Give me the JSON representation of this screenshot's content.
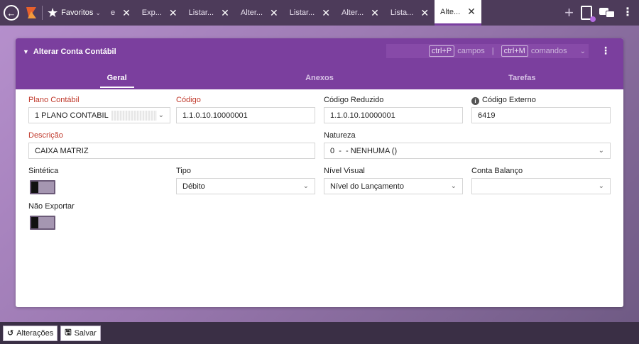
{
  "topbar": {
    "favorites_label": "Favoritos",
    "tabs": [
      {
        "label": "e",
        "active": false
      },
      {
        "label": "Exp...",
        "active": false
      },
      {
        "label": "Listar...",
        "active": false
      },
      {
        "label": "Alter...",
        "active": false
      },
      {
        "label": "Listar...",
        "active": false
      },
      {
        "label": "Alter...",
        "active": false
      },
      {
        "label": "Lista...",
        "active": false
      },
      {
        "label": "Alte...",
        "active": true
      }
    ],
    "close_glyph": "✕"
  },
  "card": {
    "title": "Alterar Conta Contábil",
    "shortcuts": {
      "key1": "ctrl+P",
      "label1": "campos",
      "separator": "|",
      "key2": "ctrl+M",
      "label2": "comandos"
    },
    "subtabs": [
      "Geral",
      "Anexos",
      "Tarefas"
    ]
  },
  "form": {
    "plano_contabil": {
      "label": "Plano Contábil",
      "value": "1 PLANO CONTABIL"
    },
    "codigo": {
      "label": "Código",
      "value": "1.1.0.10.10000001"
    },
    "codigo_reduzido": {
      "label": "Código Reduzido",
      "value": "1.1.0.10.10000001"
    },
    "codigo_externo": {
      "label": "Código Externo",
      "value": "6419"
    },
    "descricao": {
      "label": "Descrição",
      "value": "CAIXA MATRIZ"
    },
    "natureza": {
      "label": "Natureza",
      "value": "0  -  - NENHUMA ()"
    },
    "sintetica": {
      "label": "Sintética"
    },
    "tipo": {
      "label": "Tipo",
      "value": "Débito"
    },
    "nivel_visual": {
      "label": "Nível Visual",
      "value": "Nível do Lançamento"
    },
    "conta_balanco": {
      "label": "Conta Balanço",
      "value": ""
    },
    "nao_exportar": {
      "label": "Não Exportar"
    }
  },
  "bottombar": {
    "alteracoes": "Alterações",
    "salvar": "Salvar"
  },
  "colors": {
    "accent": "#7b3f9e",
    "required_label": "#c0392b"
  }
}
